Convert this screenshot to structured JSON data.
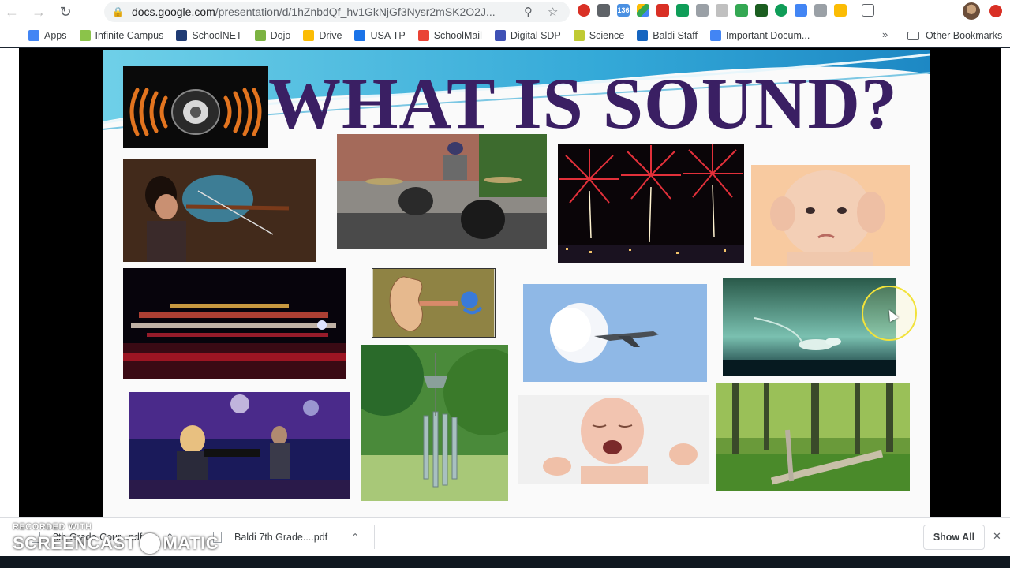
{
  "browser": {
    "url_host": "docs.google.com",
    "url_path": "/presentation/d/1hZnbdQf_hv1GkNjGf3Nysr2mSK2O2J...",
    "extension_badge": "136"
  },
  "bookmarks": {
    "items": [
      {
        "label": "Apps",
        "color": "#4285f4"
      },
      {
        "label": "Infinite Campus",
        "color": "#8bc34a"
      },
      {
        "label": "SchoolNET",
        "color": "#1f3b73"
      },
      {
        "label": "Dojo",
        "color": "#7cb342"
      },
      {
        "label": "Drive",
        "color": "#fbbc04"
      },
      {
        "label": "USA TP",
        "color": "#1a73e8"
      },
      {
        "label": "SchoolMail",
        "color": "#ea4335"
      },
      {
        "label": "Digital SDP",
        "color": "#3f51b5"
      },
      {
        "label": "Science",
        "color": "#c0ca33"
      },
      {
        "label": "Baldi Staff",
        "color": "#1565c0"
      },
      {
        "label": "Important Docum...",
        "color": "#4285f4"
      }
    ],
    "other": "Other Bookmarks"
  },
  "slide": {
    "title": "WHAT IS SOUND?"
  },
  "downloads": {
    "items": [
      {
        "name": "8th Grade Cour...pdf"
      },
      {
        "name": "Baldi 7th Grade....pdf"
      }
    ],
    "show_all": "Show All"
  },
  "watermark": {
    "top": "RECORDED WITH",
    "left": "SCREENCAST",
    "right": "MATIC"
  },
  "colors": {
    "title": "#3a1f63",
    "wave": "#2aa6d6"
  }
}
